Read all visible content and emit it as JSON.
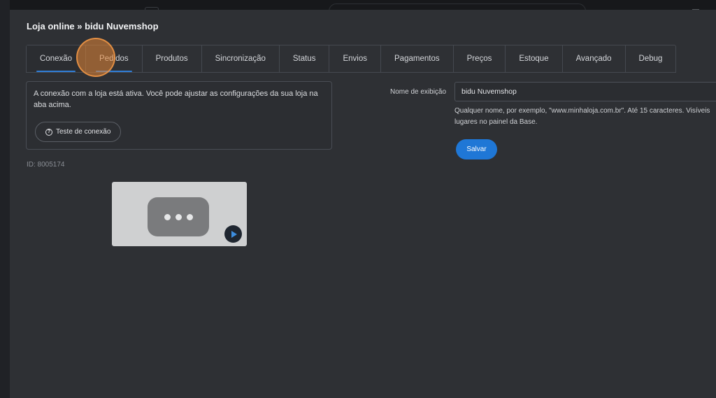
{
  "window": {
    "title": "Loja online » bidu Nuvemshop"
  },
  "tabs": [
    {
      "label": "Conexão"
    },
    {
      "label": "Pedidos"
    },
    {
      "label": "Produtos"
    },
    {
      "label": "Sincronização"
    },
    {
      "label": "Status"
    },
    {
      "label": "Envios"
    },
    {
      "label": "Pagamentos"
    },
    {
      "label": "Preços"
    },
    {
      "label": "Estoque"
    },
    {
      "label": "Avançado"
    },
    {
      "label": "Debug"
    }
  ],
  "connection": {
    "message": "A conexão com a loja está ativa. Você pode ajustar as configurações da sua loja na aba acima.",
    "test_button": "Teste de conexão",
    "test_icon": "question-circle-icon",
    "id_text": "ID: 8005174"
  },
  "video": {
    "play_icon": "play-icon",
    "placeholder_icon": "more-dots-icon"
  },
  "display_name": {
    "label": "Nome de exibição",
    "value": "bidu Nuvemshop",
    "hint": "Qualquer nome, por exemplo, \"www.minhaloja.com.br\". Até 15 caracteres. Visíveis lugares no painel da Base.",
    "save_button": "Salvar"
  },
  "colors": {
    "accent": "#1f77d6",
    "modal_bg": "#2e3034",
    "cursor_highlight": "#e68737"
  }
}
